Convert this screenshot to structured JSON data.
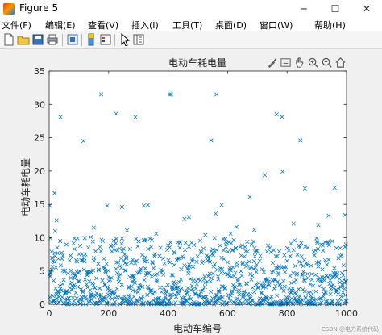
{
  "window": {
    "title": "Figure 5",
    "buttons": {
      "minimize": "─",
      "maximize": "☐",
      "close": "✕"
    }
  },
  "menu": [
    "文件(F)",
    "编辑(E)",
    "查看(V)",
    "插入(I)",
    "工具(T)",
    "桌面(D)",
    "窗口(W)",
    "帮助(H)"
  ],
  "toolbar_icons": [
    "new-figure-icon",
    "open-file-icon",
    "save-icon",
    "print-icon",
    "link-figure-icon",
    "insert-colorbar-icon",
    "insert-legend-icon",
    "pointer-icon",
    "property-inspector-icon"
  ],
  "axes_toolbar_icons": [
    "brush-icon",
    "data-tips-icon",
    "pan-hand-icon",
    "zoom-in-icon",
    "zoom-out-icon",
    "home-icon"
  ],
  "credit": "CSDN @电力系统代码",
  "colors": {
    "marker": "#0072bd",
    "axes_bg": "#ffffff",
    "figure_bg": "#f0f0f0"
  },
  "chart_data": {
    "type": "scatter",
    "title": "电动车耗电量",
    "xlabel": "电动车编号",
    "ylabel": "电动车耗电量",
    "marker": "x",
    "xlim": [
      0,
      1000
    ],
    "ylim": [
      0,
      35
    ],
    "xticks": [
      "0",
      "200",
      "400",
      "600",
      "800",
      "1000"
    ],
    "yticks": [
      "0",
      "5",
      "10",
      "15",
      "20",
      "25",
      "30",
      "35"
    ],
    "grid": false,
    "points": [
      {
        "x": 2,
        "y": 14.8
      },
      {
        "x": 18,
        "y": 16.7
      },
      {
        "x": 25,
        "y": 12.6
      },
      {
        "x": 38,
        "y": 28.1
      },
      {
        "x": 115,
        "y": 24.5
      },
      {
        "x": 175,
        "y": 31.5
      },
      {
        "x": 195,
        "y": 14.8
      },
      {
        "x": 225,
        "y": 28.6
      },
      {
        "x": 245,
        "y": 14.6
      },
      {
        "x": 290,
        "y": 28.1
      },
      {
        "x": 318,
        "y": 14.8
      },
      {
        "x": 332,
        "y": 14.9
      },
      {
        "x": 405,
        "y": 31.5
      },
      {
        "x": 410,
        "y": 31.5
      },
      {
        "x": 470,
        "y": 13.1
      },
      {
        "x": 545,
        "y": 24.6
      },
      {
        "x": 563,
        "y": 31.5
      },
      {
        "x": 580,
        "y": 14.9
      },
      {
        "x": 675,
        "y": 16.1
      },
      {
        "x": 725,
        "y": 19.4
      },
      {
        "x": 765,
        "y": 28.5
      },
      {
        "x": 783,
        "y": 28.1
      },
      {
        "x": 785,
        "y": 19.9
      },
      {
        "x": 845,
        "y": 24.6
      },
      {
        "x": 860,
        "y": 17.4
      },
      {
        "x": 960,
        "y": 17.5
      },
      {
        "x": 940,
        "y": 13.3
      },
      {
        "x": 995,
        "y": 13.4
      },
      {
        "x": 822,
        "y": 12.1
      },
      {
        "x": 690,
        "y": 11.2
      },
      {
        "x": 560,
        "y": 13.6
      },
      {
        "x": 455,
        "y": 12.8
      },
      {
        "x": 262,
        "y": 11.1
      },
      {
        "x": 150,
        "y": 11.5
      },
      {
        "x": 85,
        "y": 9.9
      },
      {
        "x": 20,
        "y": 11.0
      },
      {
        "x": 630,
        "y": 11.6
      },
      {
        "x": 905,
        "y": 11.9
      },
      {
        "x": 525,
        "y": 10.4
      },
      {
        "x": 360,
        "y": 10.6
      },
      {
        "x": 140,
        "y": 10.1
      },
      {
        "x": 245,
        "y": 9.9
      },
      {
        "x": 610,
        "y": 10.6
      }
    ],
    "bulk": {
      "n": 1000,
      "typical_max": 10,
      "note": "dense cloud of points between 0 and about 10"
    }
  }
}
